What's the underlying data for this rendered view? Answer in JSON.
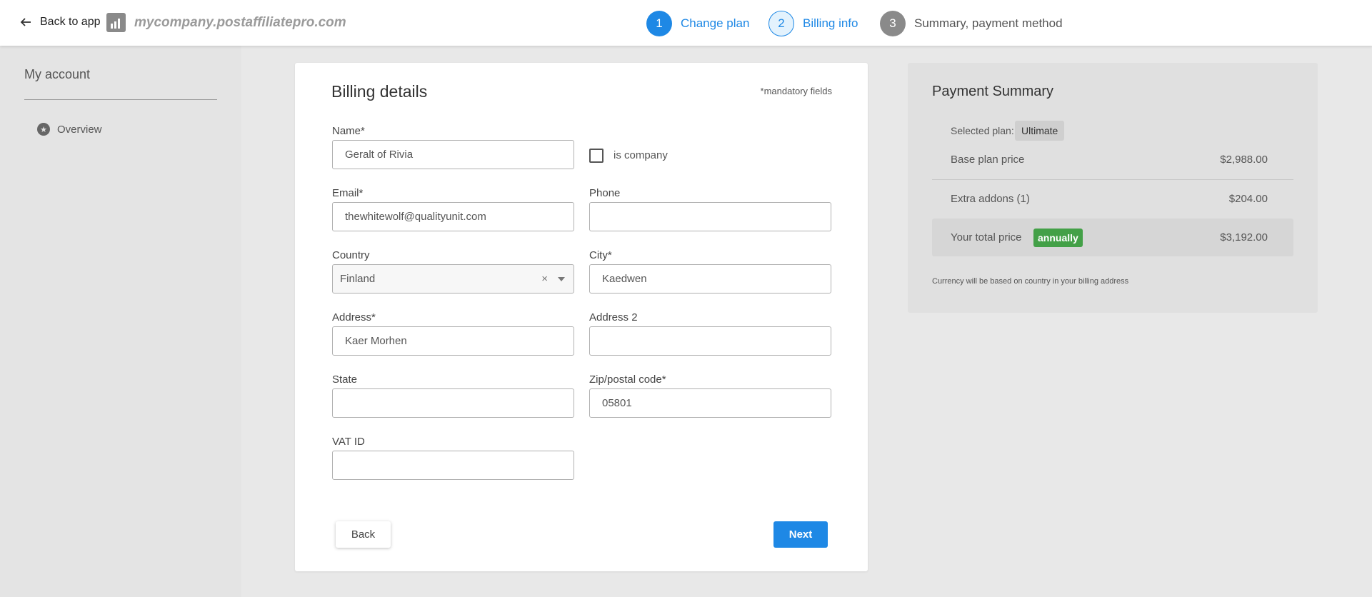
{
  "topbar": {
    "back_label": "Back to app",
    "domain": "mycompany.postaffiliatepro.com",
    "steps": [
      {
        "number": "1",
        "label": "Change plan"
      },
      {
        "number": "2",
        "label": "Billing info"
      },
      {
        "number": "3",
        "label": "Summary, payment method"
      }
    ]
  },
  "sidebar": {
    "title": "My account",
    "items": [
      {
        "label": "Overview",
        "icon": "star-circle-icon"
      }
    ]
  },
  "billing": {
    "title": "Billing details",
    "mandatory_note": "*mandatory fields",
    "name": {
      "label": "Name*",
      "value": "Geralt of Rivia"
    },
    "is_company": {
      "label": "is company",
      "checked": false
    },
    "email": {
      "label": "Email*",
      "value": "thewhitewolf@qualityunit.com"
    },
    "phone": {
      "label": "Phone",
      "value": ""
    },
    "country": {
      "label": "Country",
      "value": "Finland",
      "clear_symbol": "×"
    },
    "city": {
      "label": "City*",
      "value": "Kaedwen"
    },
    "address": {
      "label": "Address*",
      "value": "Kaer Morhen"
    },
    "address2": {
      "label": "Address 2",
      "value": ""
    },
    "state": {
      "label": "State",
      "value": ""
    },
    "zip": {
      "label": "Zip/postal code*",
      "value": "05801"
    },
    "vat": {
      "label": "VAT ID",
      "value": ""
    },
    "back_button": "Back",
    "next_button": "Next"
  },
  "summary": {
    "title": "Payment Summary",
    "selected_plan_label": "Selected plan:",
    "selected_plan": "Ultimate",
    "base_price_label": "Base plan price",
    "base_price": "$2,988.00",
    "addons_label": "Extra addons (1)",
    "addons_price": "$204.00",
    "total_label": "Your total price",
    "billing_period": "annually",
    "total_price": "$3,192.00",
    "currency_note": "Currency will be based on country in your billing address"
  },
  "colors": {
    "accent": "#1e88e5",
    "badge_green": "#43a047"
  }
}
